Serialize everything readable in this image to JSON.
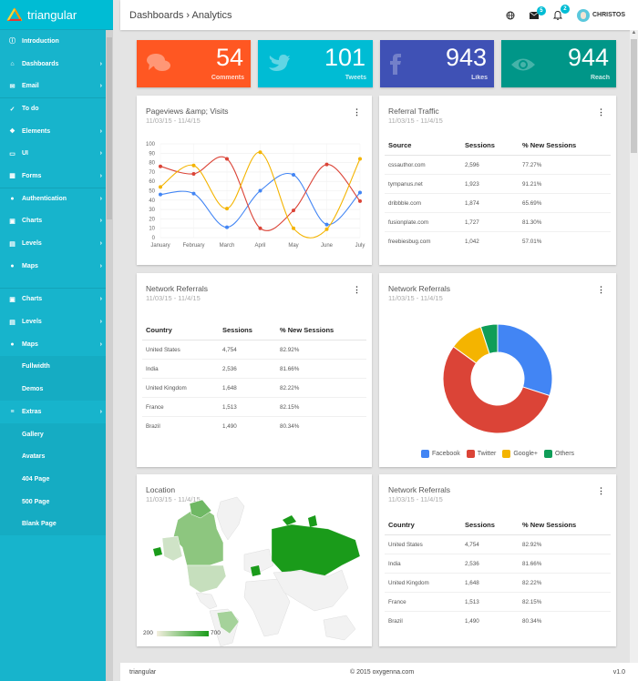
{
  "brand": {
    "name": "triangular"
  },
  "sidebar": {
    "items": [
      {
        "label": "Introduction",
        "icon": "info-icon",
        "chevron": false
      },
      {
        "label": "Dashboards",
        "icon": "home-icon",
        "chevron": true
      },
      {
        "label": "Email",
        "icon": "email-icon",
        "chevron": true
      },
      {
        "label": "To do",
        "icon": "check-icon",
        "chevron": false
      },
      {
        "label": "Elements",
        "icon": "elements-icon",
        "chevron": true
      },
      {
        "label": "UI",
        "icon": "ui-icon",
        "chevron": true
      },
      {
        "label": "Forms",
        "icon": "forms-icon",
        "chevron": true
      },
      {
        "label": "Authentication",
        "icon": "user-icon",
        "chevron": true
      },
      {
        "label": "Charts",
        "icon": "chart-icon",
        "chevron": true
      },
      {
        "label": "Levels",
        "icon": "levels-icon",
        "chevron": true
      },
      {
        "label": "Maps",
        "icon": "map-pin-icon",
        "chevron": true
      }
    ],
    "items2": [
      {
        "label": "Charts",
        "icon": "chart-icon",
        "chevron": true
      },
      {
        "label": "Levels",
        "icon": "levels-icon",
        "chevron": true
      },
      {
        "label": "Maps",
        "icon": "map-pin-icon",
        "chevron": true
      },
      {
        "label": "Fullwidth",
        "sub": true
      },
      {
        "label": "Demos",
        "sub": true
      },
      {
        "label": "Extras",
        "icon": "extras-icon",
        "chevron": true
      },
      {
        "label": "Gallery",
        "sub": true
      },
      {
        "label": "Avatars",
        "sub": true
      },
      {
        "label": "404 Page",
        "sub": true
      },
      {
        "label": "500 Page",
        "sub": true
      },
      {
        "label": "Blank Page",
        "sub": true
      }
    ]
  },
  "header": {
    "breadcrumb": "Dashboards › Analytics",
    "messages_count": "5",
    "notifications_count": "2",
    "user_name": "CHRISTOS"
  },
  "stats": [
    {
      "value": "54",
      "label": "Comments",
      "icon": "comments-icon",
      "color": "#ff5722"
    },
    {
      "value": "101",
      "label": "Tweets",
      "icon": "twitter-icon",
      "color": "#00bcd4"
    },
    {
      "value": "943",
      "label": "Likes",
      "icon": "facebook-icon",
      "color": "#3f51b5"
    },
    {
      "value": "944",
      "label": "Reach",
      "icon": "eye-icon",
      "color": "#009688"
    }
  ],
  "pageviews": {
    "title": "Pageviews &amp; Visits",
    "date": "11/03/15 - 11/4/15"
  },
  "referral": {
    "title": "Referral Traffic",
    "date": "11/03/15 - 11/4/15",
    "headers": [
      "Source",
      "Sessions",
      "% New Sessions"
    ],
    "rows": [
      [
        "cssauthor.com",
        "2,596",
        "77.27%"
      ],
      [
        "tympanus.net",
        "1,923",
        "91.21%"
      ],
      [
        "dribbble.com",
        "1,874",
        "65.69%"
      ],
      [
        "fusionplate.com",
        "1,727",
        "81.30%"
      ],
      [
        "freebiesbug.com",
        "1,042",
        "57.01%"
      ]
    ]
  },
  "network1": {
    "title": "Network Referrals",
    "date": "11/03/15 - 11/4/15",
    "headers": [
      "Country",
      "Sessions",
      "% New Sessions"
    ],
    "rows": [
      [
        "United States",
        "4,754",
        "82.92%"
      ],
      [
        "India",
        "2,536",
        "81.66%"
      ],
      [
        "United Kingdom",
        "1,648",
        "82.22%"
      ],
      [
        "France",
        "1,513",
        "82.15%"
      ],
      [
        "Brazil",
        "1,490",
        "80.34%"
      ]
    ]
  },
  "network_donut": {
    "title": "Network Referrals",
    "date": "11/03/15 - 11/4/15"
  },
  "location": {
    "title": "Location",
    "date": "11/03/15 - 11/4/15",
    "scale_min": "200",
    "scale_max": "700"
  },
  "network2": {
    "title": "Network Referrals",
    "date": "11/03/15 - 11/4/15",
    "headers": [
      "Country",
      "Sessions",
      "% New Sessions"
    ],
    "rows": [
      [
        "United States",
        "4,754",
        "82.92%"
      ],
      [
        "India",
        "2,536",
        "81.66%"
      ],
      [
        "United Kingdom",
        "1,648",
        "82.22%"
      ],
      [
        "France",
        "1,513",
        "82.15%"
      ],
      [
        "Brazil",
        "1,490",
        "80.34%"
      ]
    ]
  },
  "footer": {
    "left": "triangular",
    "center": "© 2015 oxygenna.com",
    "right": "v1.0"
  },
  "chart_data": [
    {
      "type": "line",
      "title": "Pageviews &amp; Visits",
      "categories": [
        "January",
        "February",
        "March",
        "April",
        "May",
        "June",
        "July"
      ],
      "ylim": [
        0,
        100
      ],
      "yticks": [
        0,
        10,
        20,
        30,
        40,
        50,
        60,
        70,
        80,
        90,
        100
      ],
      "grid": true,
      "series": [
        {
          "name": "blue",
          "color": "#4285f4",
          "values": [
            46,
            47,
            11,
            50,
            67,
            14,
            48
          ]
        },
        {
          "name": "red",
          "color": "#db4437",
          "values": [
            76,
            68,
            84,
            10,
            29,
            78,
            39
          ]
        },
        {
          "name": "yellow",
          "color": "#f4b400",
          "values": [
            54,
            77,
            31,
            91,
            10,
            9,
            84
          ]
        }
      ]
    },
    {
      "type": "pie",
      "title": "Network Referrals",
      "donut": true,
      "legend": "bottom",
      "slices": [
        {
          "label": "Facebook",
          "value": 30,
          "color": "#4285f4"
        },
        {
          "label": "Twitter",
          "value": 55,
          "color": "#db4437"
        },
        {
          "label": "Google+",
          "value": 10,
          "color": "#f4b400"
        },
        {
          "label": "Others",
          "value": 5,
          "color": "#0f9d58"
        }
      ]
    }
  ]
}
